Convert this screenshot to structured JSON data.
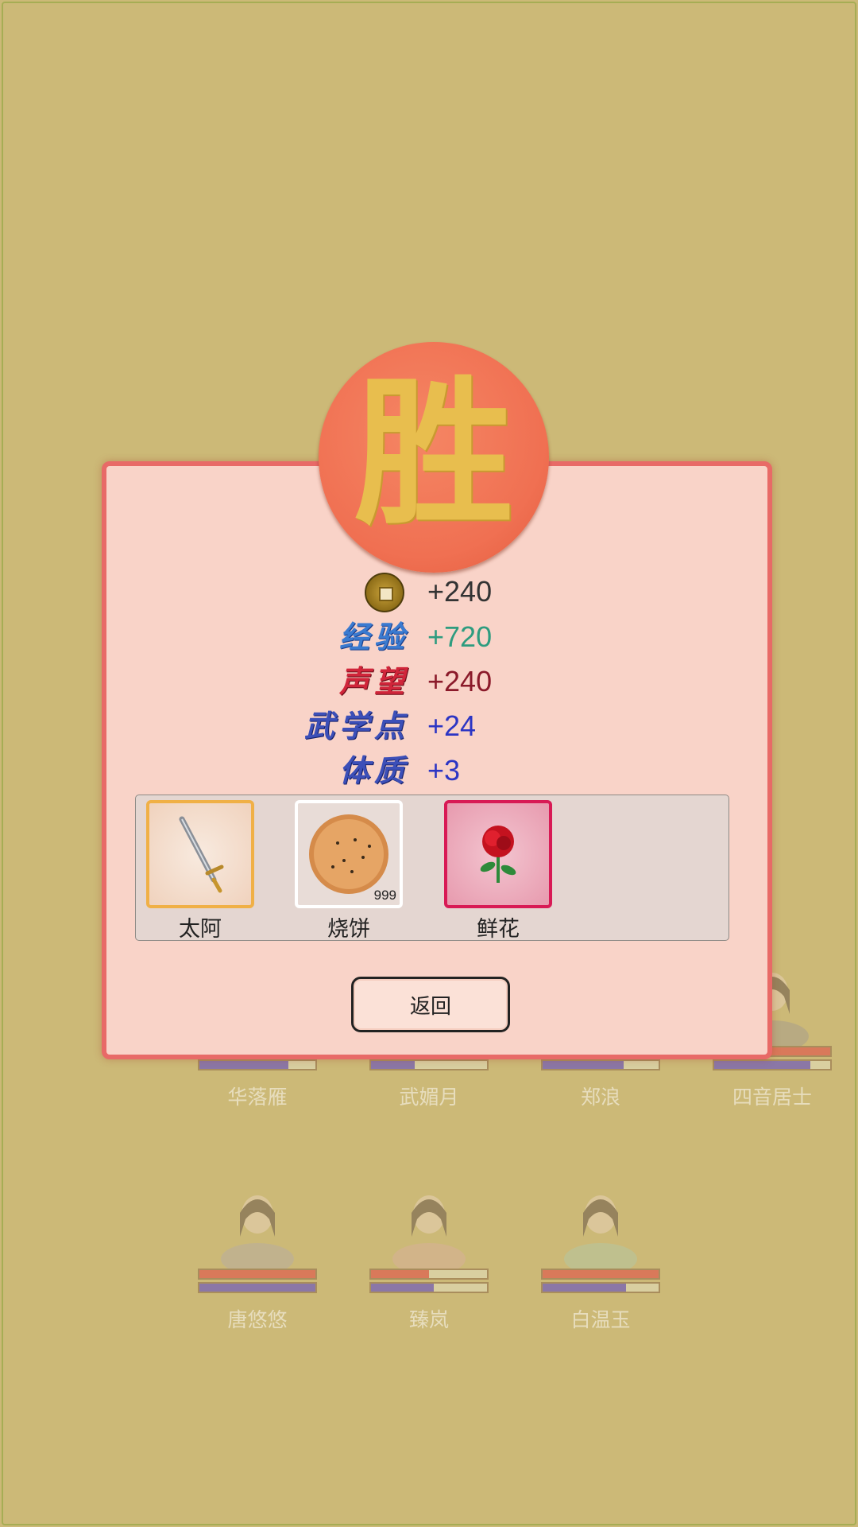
{
  "colors": {
    "background": "#ccb977",
    "dialog_fill": "#f9d3c8",
    "dialog_border": "#e86a67",
    "seal": "#f07052",
    "seal_glyph": "#e8be4e"
  },
  "seal": {
    "glyph": "胜"
  },
  "rewards": [
    {
      "icon": "copper-coin-icon",
      "label": "",
      "value": "+240",
      "color": "#333333"
    },
    {
      "label": "经验",
      "value": "+720",
      "color": "#2e9c7f",
      "label_color": "#3a7ad0"
    },
    {
      "label": "声望",
      "value": "+240",
      "color": "#8b1a2a",
      "label_color": "#d0253a"
    },
    {
      "label": "武学点",
      "value": "+24",
      "color": "#2c35c4",
      "label_color": "#3c4fb8"
    },
    {
      "label": "体质",
      "value": "+3",
      "color": "#2c35c4",
      "label_color": "#3c4fb8"
    }
  ],
  "items": [
    {
      "name": "太阿",
      "icon": "sword-icon",
      "border": "#f0b046",
      "count": ""
    },
    {
      "name": "烧饼",
      "icon": "sesame-flatbread-icon",
      "border": "#ffffff",
      "count": "999"
    },
    {
      "name": "鲜花",
      "icon": "red-rose-icon",
      "border": "#d81a55",
      "count": ""
    }
  ],
  "back_button": {
    "label": "返回"
  },
  "characters": [
    {
      "name": "华落雁",
      "hp": 1.0,
      "mp": 0.77
    },
    {
      "name": "武媚月",
      "hp": 1.0,
      "mp": 0.38
    },
    {
      "name": "郑浪",
      "hp": 1.0,
      "mp": 0.7
    },
    {
      "name": "四音居士",
      "hp": 1.0,
      "mp": 0.83
    },
    {
      "name": "唐悠悠",
      "hp": 1.0,
      "mp": 1.0
    },
    {
      "name": "臻岚",
      "hp": 0.5,
      "mp": 0.54
    },
    {
      "name": "白温玉",
      "hp": 1.0,
      "mp": 0.72
    }
  ]
}
